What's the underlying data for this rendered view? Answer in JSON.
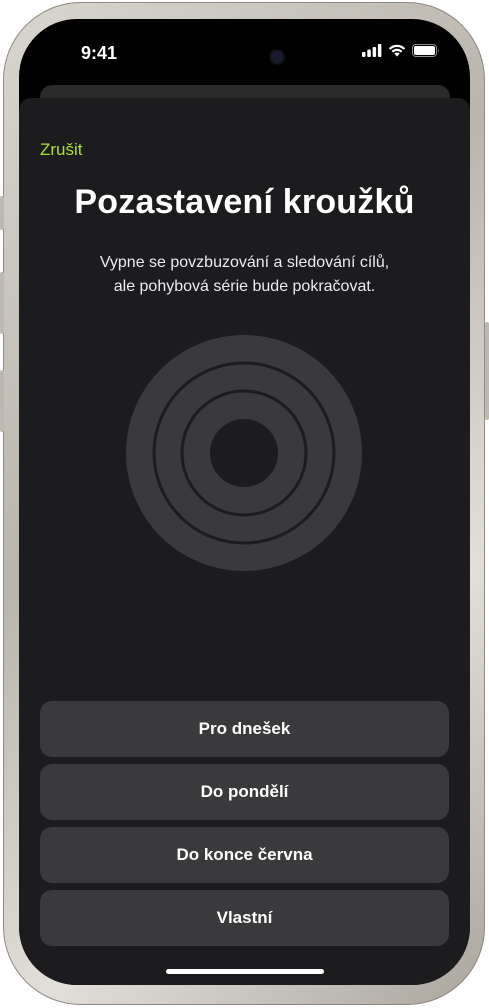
{
  "status": {
    "time": "9:41"
  },
  "sheet": {
    "cancel_label": "Zrušit",
    "title": "Pozastavení kroužků",
    "subtitle_line1": "Vypne se povzbuzování a sledování cílů,",
    "subtitle_line2": "ale pohybová série bude pokračovat."
  },
  "options": [
    {
      "label": "Pro dnešek"
    },
    {
      "label": "Do pondělí"
    },
    {
      "label": "Do konce června"
    },
    {
      "label": "Vlastní"
    }
  ],
  "colors": {
    "accent": "#a7e32a",
    "sheet_bg": "#1c1c1e",
    "button_bg": "#3a3a3c",
    "ring_fill": "#3a3a3c"
  },
  "icons": [
    "signal-icon",
    "wifi-icon",
    "battery-icon",
    "activity-rings-icon"
  ]
}
